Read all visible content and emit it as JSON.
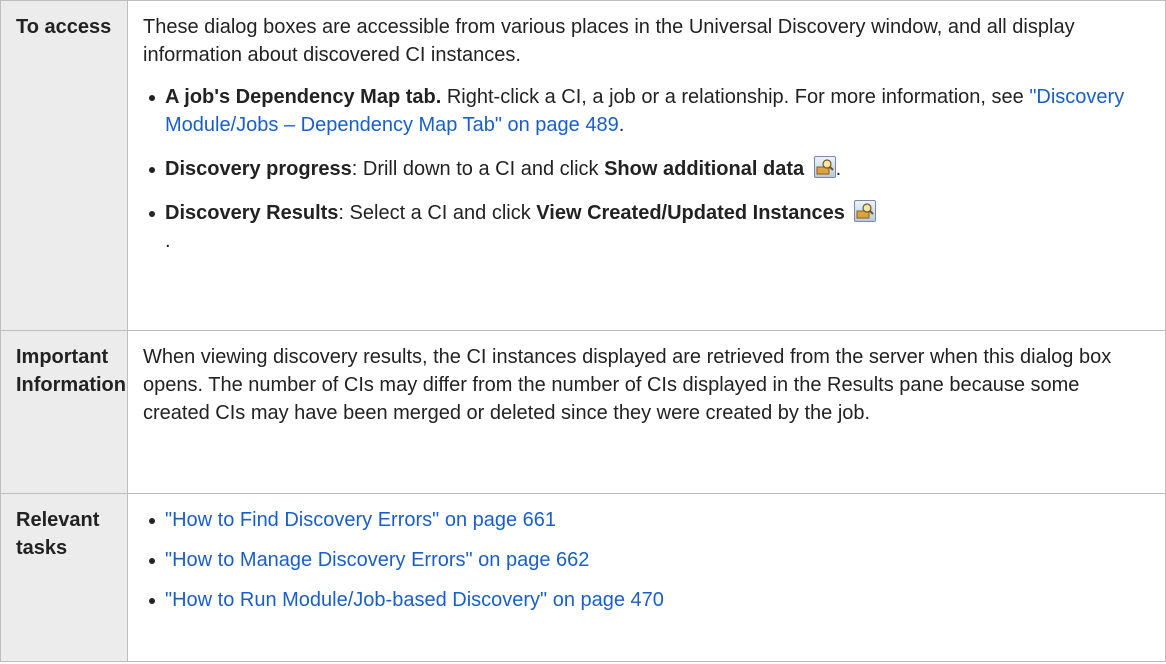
{
  "rows": {
    "access": {
      "label": "To access",
      "intro": "These dialog boxes are accessible from various places in the Universal Discovery window, and all display information about discovered CI instances.",
      "bullet1": {
        "bold": "A job's Dependency Map tab.",
        "text": " Right-click a CI, a job or a relationship. For more information, see ",
        "link": "\"Discovery Module/Jobs – Dependency Map Tab\" on page 489",
        "end": "."
      },
      "bullet2": {
        "bold": "Discovery progress",
        "text": ": Drill down to a CI and click ",
        "bold2": "Show additional data",
        "icon": "show-data-icon",
        "end": "."
      },
      "bullet3": {
        "bold": "Discovery Results",
        "text": ": Select a CI and click ",
        "bold2": "View Created/Updated Instances",
        "icon": "view-instances-icon",
        "end": "."
      }
    },
    "important": {
      "label": "Important Information",
      "text": "When viewing discovery results, the CI instances displayed are retrieved from the server when this dialog box opens. The number of CIs may differ from the number of CIs displayed in the Results pane because some created CIs may have been merged or deleted since they were created by the job."
    },
    "tasks": {
      "label": "Relevant tasks",
      "links": [
        "\"How to Find Discovery Errors\" on page 661",
        "\"How to Manage Discovery Errors\" on page 662",
        "\"How to Run Module/Job-based Discovery\" on page 470"
      ]
    }
  },
  "colors": {
    "link": "#1a5fc8",
    "label_bg": "#ececec",
    "border": "#bdbdbd"
  }
}
